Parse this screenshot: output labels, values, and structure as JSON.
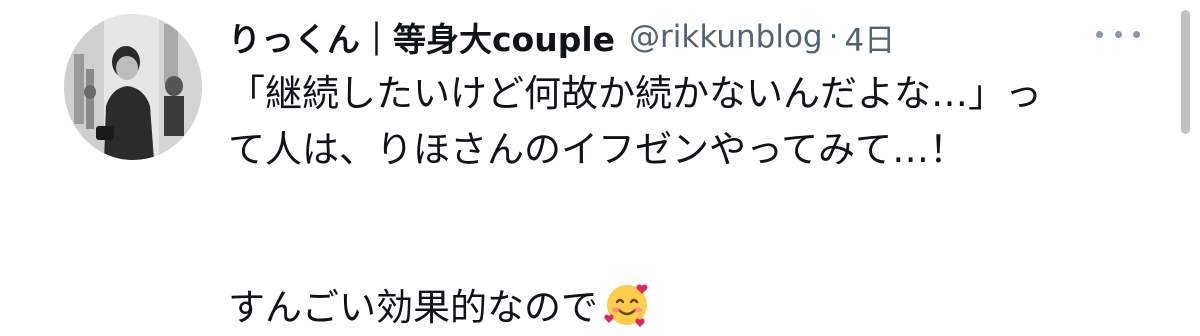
{
  "tweet": {
    "display_name": "りっくん｜等身大couple",
    "handle": "@rikkunblog",
    "separator": "·",
    "time": "4日",
    "body_line1": "「継続したいけど何故か続かないんだよな…」っ",
    "body_line2": "て人は、りほさんのイフゼンやってみて…！",
    "body_line3": "すんごい効果的なので",
    "emoji": "smiling-face-with-hearts-emoji"
  },
  "icons": {
    "more": "more-horizontal-icon",
    "avatar": "profile-photo"
  },
  "colors": {
    "text_primary": "#0f1419",
    "text_secondary": "#536471",
    "background": "#ffffff"
  }
}
